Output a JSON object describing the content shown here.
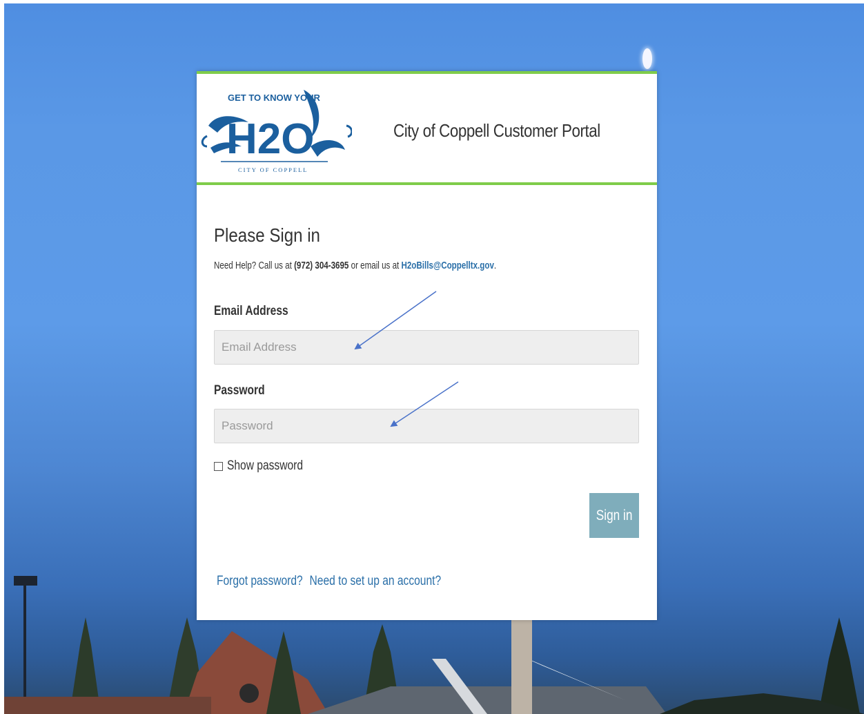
{
  "header": {
    "logo_top_text": "GET TO KNOW YOUR",
    "logo_main_text": "H2O",
    "logo_bottom_text": "CITY OF COPPELL",
    "portal_title": "City of Coppell Customer Portal"
  },
  "form": {
    "heading": "Please Sign in",
    "help_prefix": "Need Help? Call us at ",
    "help_phone": "(972) 304-3695",
    "help_middle": " or email us at ",
    "help_email": "H2oBills@Coppelltx.gov",
    "help_suffix": ".",
    "email_label": "Email Address",
    "email_placeholder": "Email Address",
    "password_label": "Password",
    "password_placeholder": "Password",
    "show_password_label": "Show password",
    "show_password_checked": false,
    "signin_label": "Sign in",
    "forgot_password_link": "Forgot password?",
    "setup_account_link": "Need to set up an account?"
  },
  "colors": {
    "accent_green": "#7fcc4a",
    "button_bg": "#7fadbb",
    "link_blue": "#2a6fa8",
    "annotation_arrow": "#4a72c9"
  }
}
